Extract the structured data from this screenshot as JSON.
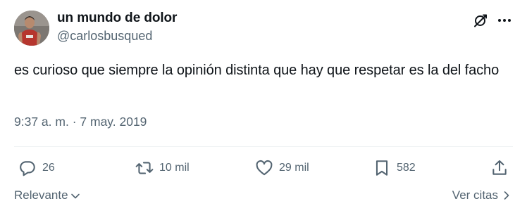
{
  "author": {
    "display_name": "un mundo de dolor",
    "handle": "@carlosbusqued"
  },
  "tweet": {
    "text": "es curioso que siempre la opinión distinta que hay que respetar es la del facho",
    "time": "9:37 a. m.",
    "separator": "·",
    "date": "7 may. 2019"
  },
  "actions": {
    "replies": "26",
    "reposts": "10 mil",
    "likes": "29 mil",
    "bookmarks": "582"
  },
  "footer": {
    "sort_label": "Relevante",
    "quotes_label": "Ver citas"
  },
  "icons": {
    "grok": "grok-icon",
    "more": "more-icon",
    "reply": "reply-icon",
    "repost": "repost-icon",
    "like": "heart-icon",
    "bookmark": "bookmark-icon",
    "share": "share-icon"
  },
  "colors": {
    "text_primary": "#0f1419",
    "text_secondary": "#536471",
    "divider": "#eff3f4"
  }
}
